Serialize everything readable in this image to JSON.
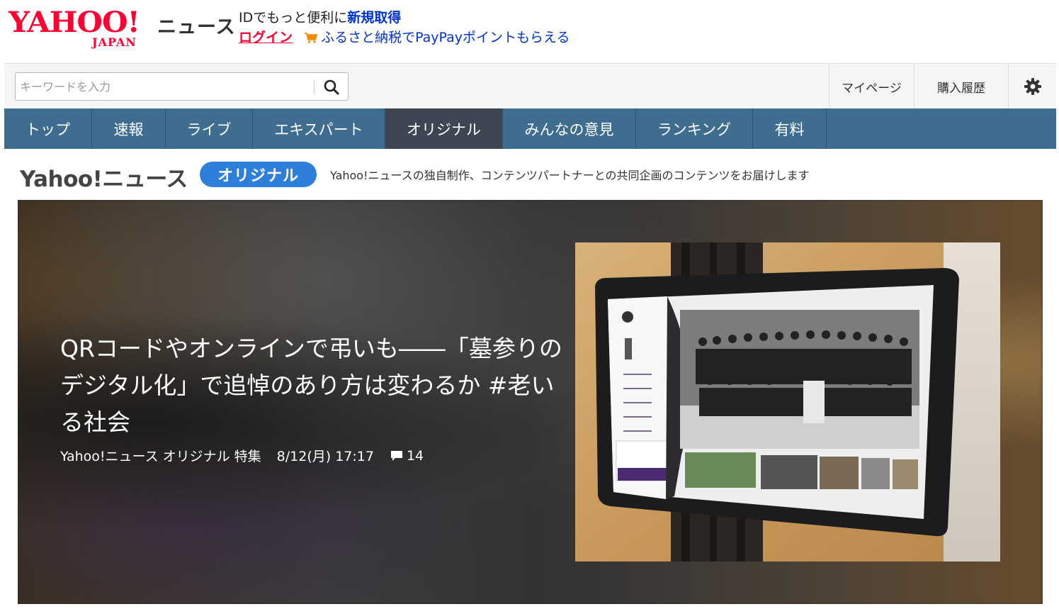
{
  "header": {
    "logo_main": "YAHOO!",
    "logo_sub": "JAPAN",
    "logo_service": "ニュース",
    "id_prompt": "IDでもっと便利に",
    "signup": "新規取得",
    "login": "ログイン",
    "furusato": "ふるさと納税でPayPayポイントもらえる"
  },
  "search": {
    "placeholder": "キーワードを入力"
  },
  "toolbar": {
    "mypage": "マイページ",
    "history": "購入履歴"
  },
  "nav": {
    "tabs": [
      {
        "label": "トップ"
      },
      {
        "label": "速報"
      },
      {
        "label": "ライブ"
      },
      {
        "label": "エキスパート"
      },
      {
        "label": "オリジナル"
      },
      {
        "label": "みんなの意見"
      },
      {
        "label": "ランキング"
      },
      {
        "label": "有料"
      }
    ],
    "active_index": 4
  },
  "original": {
    "logo": "Yahoo!ニュース",
    "badge": "オリジナル",
    "description": "Yahoo!ニュースの独自制作、コンテンツパートナーとの共同企画のコンテンツをお届けします"
  },
  "hero": {
    "title": "QRコードやオンラインで弔いも――「墓参りのデジタル化」で追悼のあり方は変わるか #老いる社会",
    "source": "Yahoo!ニュース オリジナル 特集",
    "date": "8/12(月) 17:17",
    "comment_count": "14"
  },
  "colors": {
    "brand_red": "#ff0033",
    "link_blue": "#0033cc",
    "nav_bg": "#3f6d8f",
    "nav_active": "#3d4652",
    "badge_blue": "#2e7fd9"
  },
  "icons": {
    "search": "search-icon",
    "gear": "gear-icon",
    "cart": "cart-icon",
    "comment": "comment-icon"
  }
}
